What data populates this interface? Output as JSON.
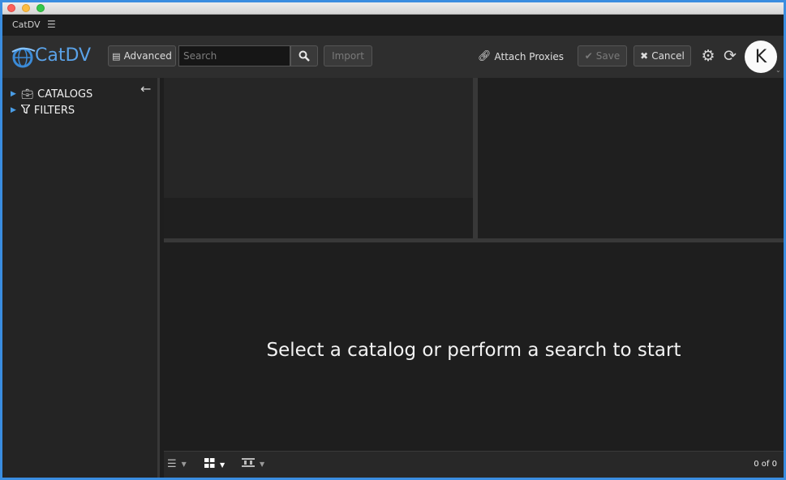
{
  "window": {
    "title": "CatDV"
  },
  "menu": {
    "icon": "hamburger-icon"
  },
  "logo": {
    "text": "CatDV",
    "color": "#5aa2e8"
  },
  "toolbar": {
    "advanced_label": "Advanced",
    "search_placeholder": "Search",
    "search_value": "",
    "import_label": "Import",
    "attach_label": "Attach Proxies",
    "save_label": "Save",
    "cancel_label": "Cancel",
    "avatar_initial": "K"
  },
  "sidebar": {
    "items": [
      {
        "label": "CATALOGS",
        "icon": "briefcase-icon"
      },
      {
        "label": "FILTERS",
        "icon": "filter-icon"
      }
    ]
  },
  "main": {
    "empty_message": "Select a catalog or perform a search to start"
  },
  "status": {
    "count": "0 of 0"
  },
  "colors": {
    "accent": "#4a9de6",
    "background": "#1e1e1e",
    "toolbar": "#2e2e2e"
  }
}
